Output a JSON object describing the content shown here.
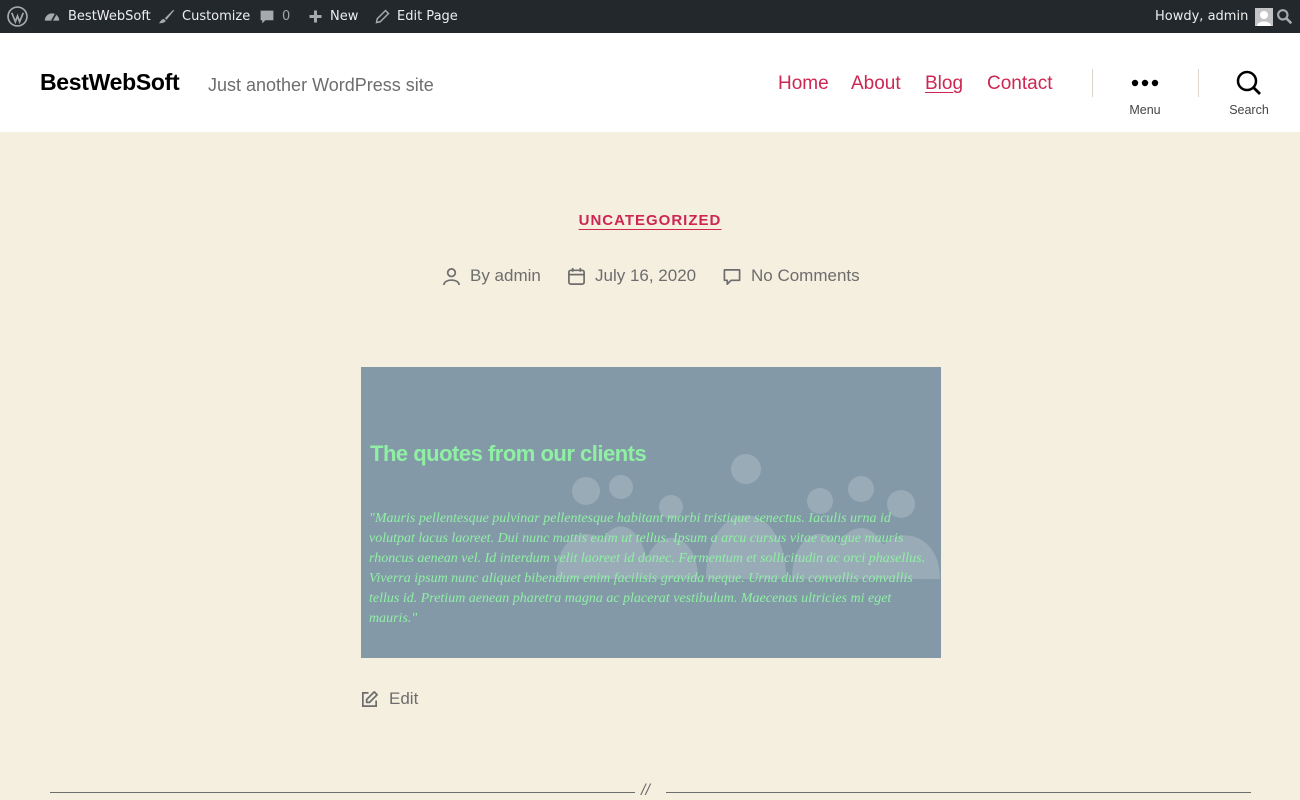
{
  "admin_bar": {
    "wp_logo_icon": "wordpress-logo-icon",
    "site_name": "BestWebSoft",
    "customize": "Customize",
    "comments_count": "0",
    "new": "New",
    "edit_page": "Edit Page",
    "howdy": "Howdy, admin"
  },
  "header": {
    "site_title": "BestWebSoft",
    "tagline": "Just another WordPress site",
    "nav": [
      "Home",
      "About",
      "Blog",
      "Contact"
    ],
    "current_nav": "Blog",
    "menu_label": "Menu",
    "search_label": "Search"
  },
  "post": {
    "category": "UNCATEGORIZED",
    "author": "By admin",
    "date": "July 16, 2020",
    "comments": "No Comments",
    "image": {
      "title": "The quotes from our clients",
      "quote": "\"Mauris pellentesque pulvinar pellentesque habitant morbi tristique senectus. Iaculis urna id volutpat lacus laoreet. Dui nunc mattis enim ut tellus. Ipsum a arcu cursus vitae congue mauris rhoncus aenean vel. Id interdum velit laoreet id donec. Fermentum et sollicitudin ac orci phasellus. Viverra ipsum nunc aliquet bibendum enim facilisis gravida neque. Urna duis convallis convallis tellus id. Pretium aenean pharetra magna ac placerat vestibulum. Maecenas ultricies mi eget mauris.\"",
      "background_color": "#8399a8",
      "text_color": "#8ff0a4"
    },
    "edit": "Edit",
    "separator_mark": "//"
  },
  "colors": {
    "accent": "#cd2653",
    "page_background": "#f5efe0",
    "admin_bar": "#23282d"
  }
}
